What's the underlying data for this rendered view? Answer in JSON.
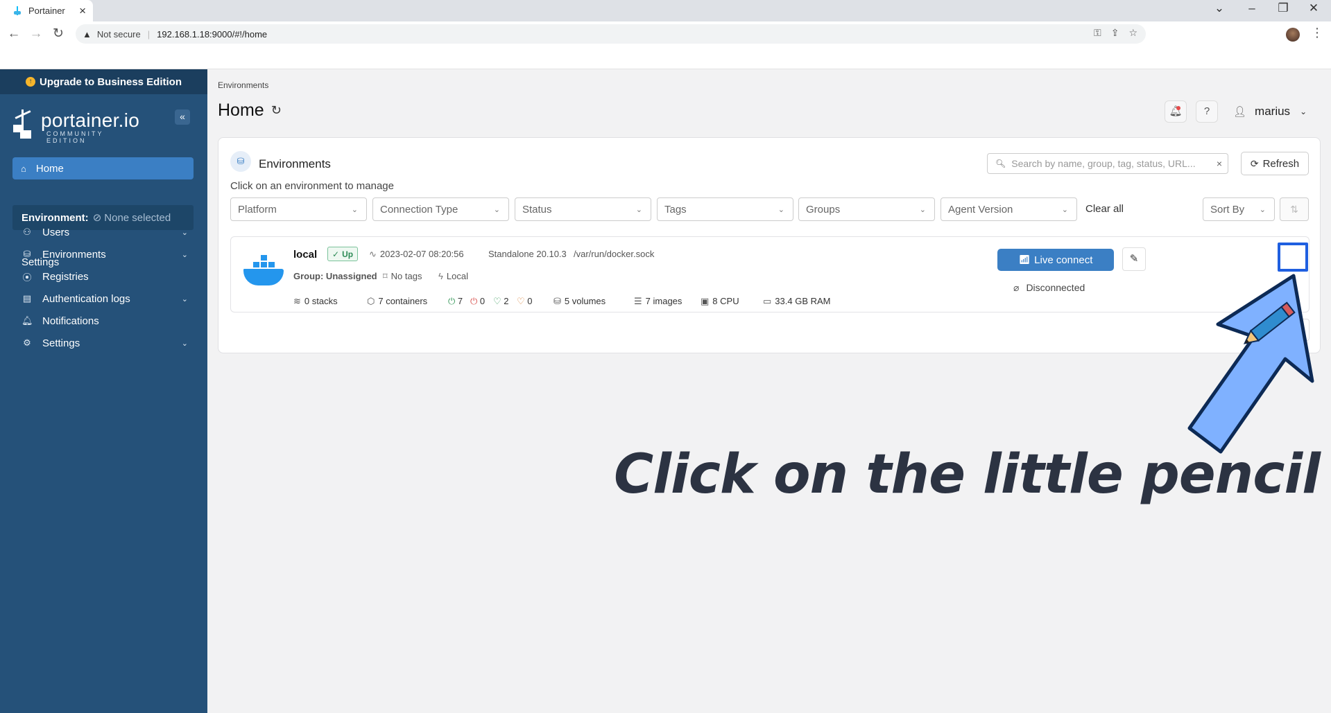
{
  "browser": {
    "tab_title": "Portainer",
    "security_label": "Not secure",
    "url": "192.168.1.18:9000/#!/home"
  },
  "sidebar": {
    "upgrade_label": "Upgrade to Business Edition",
    "logo_name": "portainer.io",
    "logo_sub": "COMMUNITY EDITION",
    "home_label": "Home",
    "environment_label": "Environment:",
    "environment_value": "None selected",
    "settings_heading": "Settings",
    "items": [
      {
        "label": "Users",
        "icon": "users-icon"
      },
      {
        "label": "Environments",
        "icon": "environments-icon"
      },
      {
        "label": "Registries",
        "icon": "registries-icon"
      },
      {
        "label": "Authentication logs",
        "icon": "auth-logs-icon"
      },
      {
        "label": "Notifications",
        "icon": "bell-icon"
      },
      {
        "label": "Settings",
        "icon": "gear-icon"
      }
    ]
  },
  "header": {
    "breadcrumb": "Environments",
    "title": "Home",
    "username": "marius"
  },
  "environments": {
    "title": "Environments",
    "subtitle": "Click on an environment to manage",
    "search_placeholder": "Search by name, group, tag, status, URL...",
    "refresh_label": "Refresh",
    "filters": [
      "Platform",
      "Connection Type",
      "Status",
      "Tags",
      "Groups",
      "Agent Version"
    ],
    "clear_all": "Clear all",
    "sort_by": "Sort By"
  },
  "env_card": {
    "name": "local",
    "status": "Up",
    "timestamp": "2023-02-07 08:20:56",
    "engine": "Standalone 20.10.3",
    "socket": "/var/run/docker.sock",
    "group": "Group: Unassigned",
    "tags": "No tags",
    "type": "Local",
    "stacks": "0 stacks",
    "containers": "7 containers",
    "running": "7",
    "stopped": "0",
    "healthy": "2",
    "unhealthy": "0",
    "volumes": "5 volumes",
    "images": "7 images",
    "cpu": "8 CPU",
    "ram": "33.4 GB RAM",
    "live_connect": "Live connect",
    "disconnected": "Disconnected"
  },
  "annotation": {
    "text": "Click on the little pencil",
    "arrow_color": "#7fb1ff",
    "highlight_color": "#1f5fe0"
  }
}
